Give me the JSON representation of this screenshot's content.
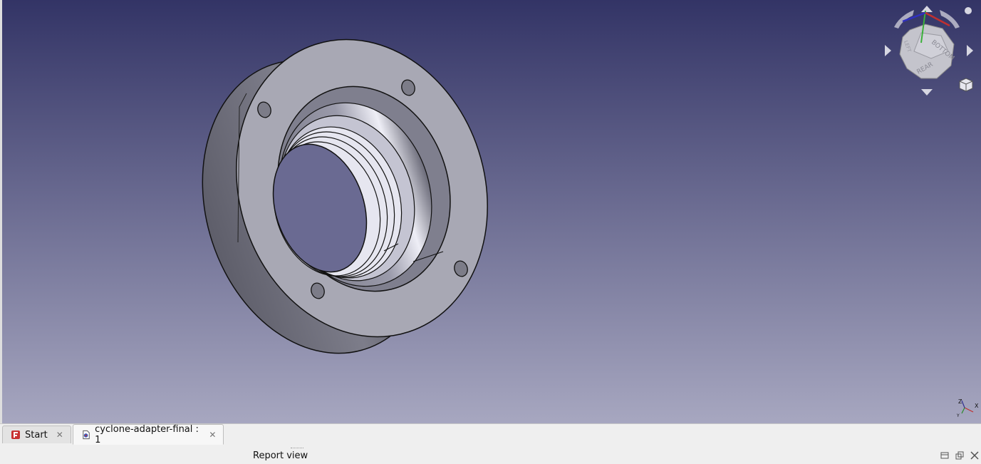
{
  "tabs": [
    {
      "label": "Start",
      "icon": "freecad-start-icon",
      "active": false
    },
    {
      "label": "cyclone-adapter-final : 1",
      "icon": "document-part-icon",
      "active": true
    }
  ],
  "report_view": {
    "title": "Report view"
  },
  "nav_cube": {
    "top_face": "BOTTOM",
    "front_face": "REAR",
    "side_face": "LEFT"
  },
  "axis": {
    "x": "X",
    "z": "Z",
    "y": "Y"
  },
  "colors": {
    "bg_top": "#333466",
    "bg_bottom": "#a7a7c0",
    "model_face": "#a8a8b4",
    "tab_bar": "#efefef"
  }
}
